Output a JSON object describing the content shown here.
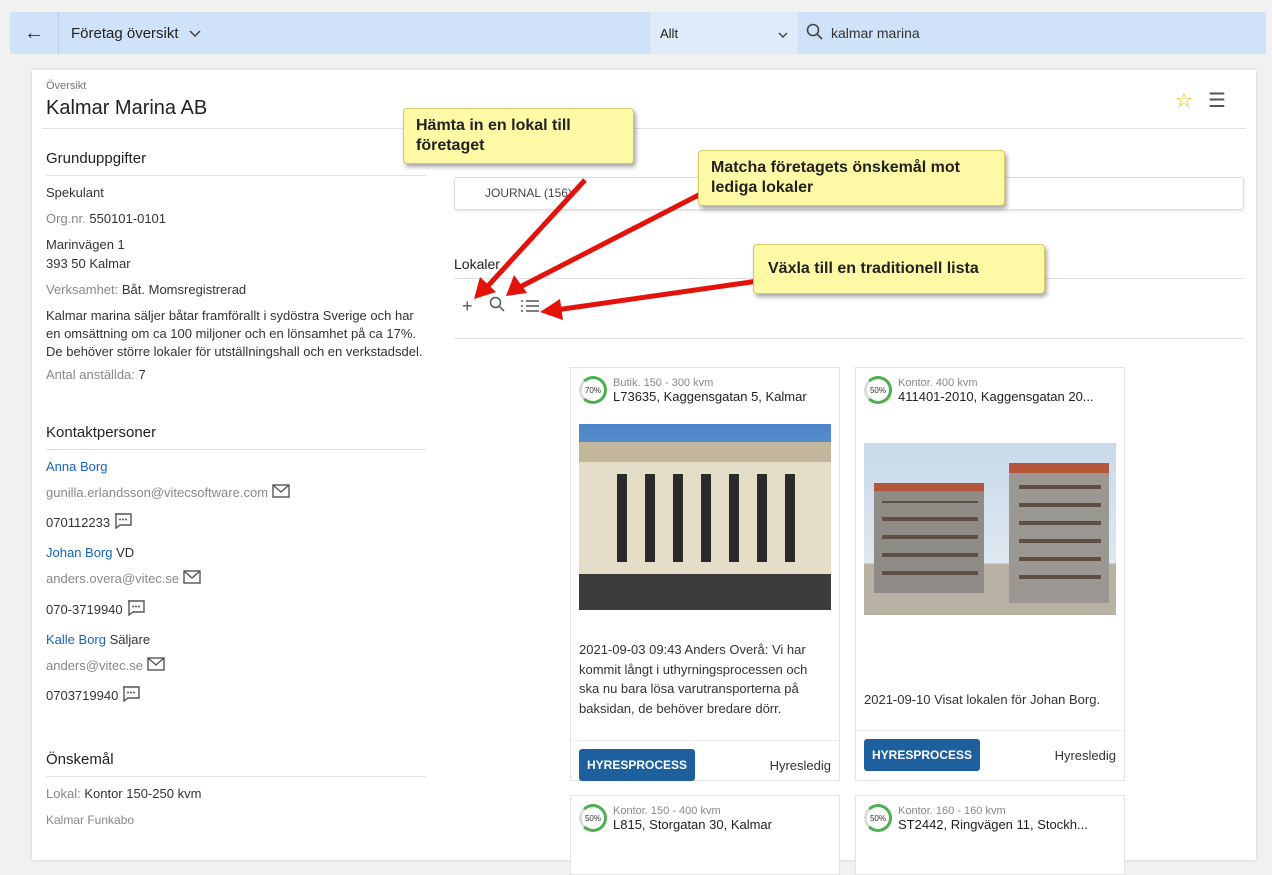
{
  "topbar": {
    "page_title": "Företag översikt",
    "filter_value": "Allt",
    "search_value": "kalmar marina"
  },
  "header": {
    "breadcrumb": "Översikt",
    "company_name": "Kalmar Marina AB"
  },
  "grund": {
    "heading": "Grunduppgifter",
    "status": "Spekulant",
    "orgnr_label": "Org.nr.",
    "orgnr": "550101-0101",
    "address1": "Marinvägen 1",
    "address2": "393 50 Kalmar",
    "verksamhet_label": "Verksamhet:",
    "verksamhet": "Båt. Momsregistrerad",
    "description": "Kalmar marina säljer båtar framförallt i sydöstra Sverige och har en omsättning om ca 100 miljoner och en lönsamhet på ca 17%. De behöver större lokaler för utställningshall och en verkstadsdel.",
    "employees_label": "Antal anställda:",
    "employees": "7"
  },
  "contacts": {
    "heading": "Kontaktpersoner",
    "people": [
      {
        "name": "Anna Borg",
        "role": "",
        "email": "gunilla.erlandsson@vitecsoftware.com",
        "phone": "070112233"
      },
      {
        "name": "Johan Borg",
        "role": "VD",
        "email": "anders.overa@vitec.se",
        "phone": "070-3719940"
      },
      {
        "name": "Kalle Borg",
        "role": "Säljare",
        "email": "anders@vitec.se",
        "phone": "0703719940"
      }
    ]
  },
  "wishes": {
    "heading": "Önskemål",
    "lokal_label": "Lokal:",
    "lokal": "Kontor 150-250 kvm",
    "area": "Kalmar Funkabo"
  },
  "journal_tab": "JOURNAL (156)",
  "lokaler_heading": "Lokaler",
  "properties": [
    {
      "percent": "70%",
      "type": "Butik. 150 - 300 kvm",
      "address": "L73635, Kaggensgatan 5, Kalmar",
      "note": "2021-09-03 09:43 Anders Overå: Vi har kommit långt i uthyrningsprocessen och ska nu bara lösa varutransporterna på baksidan, de behöver bredare dörr.",
      "button": "HYRESPROCESS",
      "status": "Hyresledig"
    },
    {
      "percent": "50%",
      "type": "Kontor. 400 kvm",
      "address": "411401-2010, Kaggensgatan 20...",
      "note": "2021-09-10 Visat lokalen för Johan Borg.",
      "button": "HYRESPROCESS",
      "status": "Hyresledig"
    },
    {
      "percent": "50%",
      "type": "Kontor. 150 - 400 kvm",
      "address": "L815, Storgatan 30, Kalmar"
    },
    {
      "percent": "50%",
      "type": "Kontor. 160 - 160 kvm",
      "address": "ST2442, Ringvägen 11, Stockh..."
    }
  ],
  "callouts": {
    "add": "Hämta in en lokal till företaget",
    "match": "Matcha företagets önskemål mot lediga lokaler",
    "list": "Växla till en traditionell lista"
  },
  "colors": {
    "accent": "#1e5f9e",
    "topbar": "#cfe2f8",
    "link": "#1565c0",
    "callout": "#fef9a5",
    "arrow": "#e3120b"
  }
}
